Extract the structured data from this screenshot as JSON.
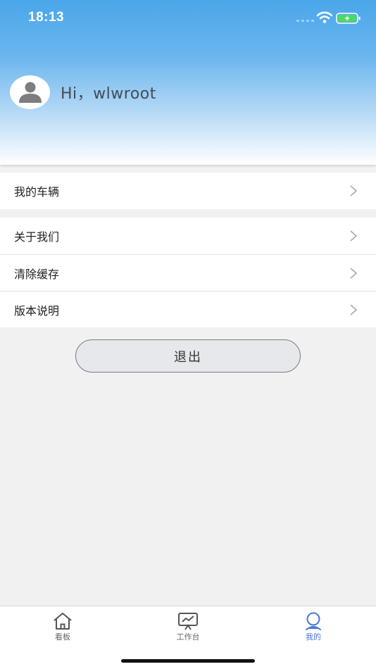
{
  "status_bar": {
    "time": "18:13"
  },
  "profile": {
    "greeting": "Hi，wlwroot"
  },
  "menu": {
    "group1": [
      {
        "label": "我的车辆"
      }
    ],
    "group2": [
      {
        "label": "关于我们"
      },
      {
        "label": "清除缓存"
      },
      {
        "label": "版本说明"
      }
    ]
  },
  "logout": {
    "label": "退出"
  },
  "tabbar": {
    "items": [
      {
        "label": "看板",
        "icon": "home-icon",
        "active": false
      },
      {
        "label": "工作台",
        "icon": "chart-monitor-icon",
        "active": false
      },
      {
        "label": "我的",
        "icon": "user-profile-icon",
        "active": true
      }
    ],
    "active_color": "#4a74d9"
  },
  "colors": {
    "header_top": "#4aa6ea",
    "background": "#f1f1f1",
    "battery_green": "#4cd964"
  }
}
